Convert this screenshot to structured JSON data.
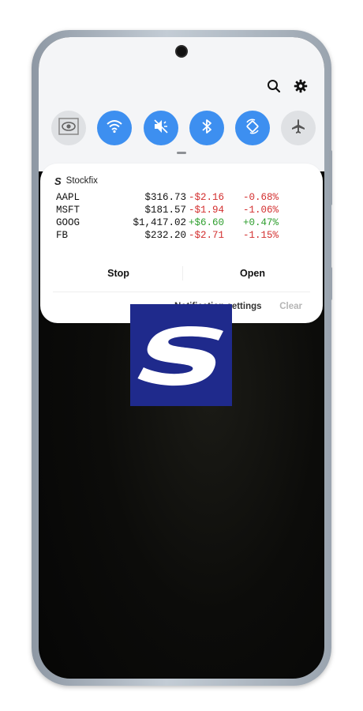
{
  "quick_settings": {
    "tiles": [
      {
        "name": "eye-comfort",
        "icon": "eye-icon",
        "state": "off"
      },
      {
        "name": "wifi",
        "icon": "wifi-icon",
        "state": "on"
      },
      {
        "name": "vibrate",
        "icon": "vibrate-icon",
        "state": "on"
      },
      {
        "name": "bluetooth",
        "icon": "bluetooth-icon",
        "state": "on"
      },
      {
        "name": "auto-rotate",
        "icon": "rotate-icon",
        "state": "on"
      },
      {
        "name": "airplane-mode",
        "icon": "airplane-icon",
        "state": "off"
      }
    ],
    "top_icons": [
      "search-icon",
      "gear-icon"
    ]
  },
  "notification": {
    "app_name": "Stockfix",
    "app_icon_glyph": "S",
    "quotes": [
      {
        "symbol": "AAPL",
        "price": "$316.73",
        "change": "-$2.16",
        "percent": "-0.68%",
        "direction": "down"
      },
      {
        "symbol": "MSFT",
        "price": "$181.57",
        "change": "-$1.94",
        "percent": "-1.06%",
        "direction": "down"
      },
      {
        "symbol": "GOOG",
        "price": "$1,417.02",
        "change": "+$6.60",
        "percent": "+0.47%",
        "direction": "up"
      },
      {
        "symbol": "FB",
        "price": "$232.20",
        "change": "-$2.71",
        "percent": "-1.15%",
        "direction": "down"
      }
    ],
    "actions": {
      "stop_label": "Stop",
      "open_label": "Open"
    },
    "footer": {
      "settings_label": "Notification settings",
      "clear_label": "Clear"
    }
  },
  "colors": {
    "accent": "#3d8ff0",
    "negative": "#d32f2f",
    "positive": "#2e9e2e",
    "logo_bg": "#1f2a8c"
  }
}
